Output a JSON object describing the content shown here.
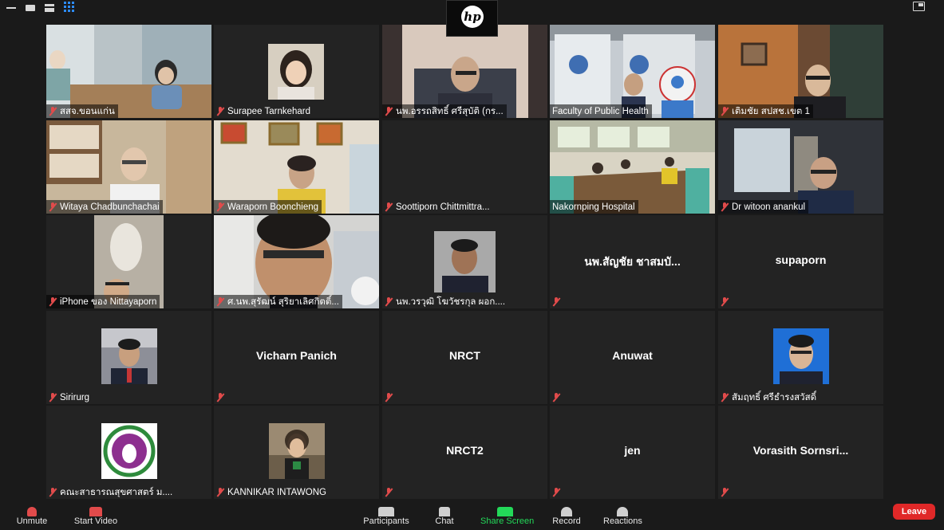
{
  "meeting": {
    "brand_logo": "hp",
    "participants": [
      {
        "name": "สสจ.ขอนแก่น",
        "muted": true,
        "video": true
      },
      {
        "name": "Surapee Tarnkehard",
        "muted": true,
        "video": false,
        "has_photo": true
      },
      {
        "name": "นพ.อรรถสิทธิ์ ศรีสุบัติ (กร...",
        "muted": true,
        "video": true
      },
      {
        "name": "Faculty of Public Health",
        "muted": false,
        "video": true,
        "active_speaker": true
      },
      {
        "name": "เติมชัย สปสช.เขต 1",
        "muted": true,
        "video": true
      },
      {
        "name": "Witaya Chadbunchachai",
        "muted": true,
        "video": true
      },
      {
        "name": "Waraporn Boonchieng",
        "muted": true,
        "video": true
      },
      {
        "name": "Soottiporn Chittmittra...",
        "muted": true,
        "video": false
      },
      {
        "name": "Nakornping Hospital",
        "muted": false,
        "video": true
      },
      {
        "name": "Dr witoon anankul",
        "muted": true,
        "video": true
      },
      {
        "name": "iPhone ของ Nittayaporn",
        "muted": true,
        "video": true
      },
      {
        "name": "ศ.นพ.สุรัฒน์ สุริยาเลิศกิตติ์...",
        "muted": true,
        "video": true
      },
      {
        "name": "นพ.วรวุฒิ โฆวัชรกุล ผอก....",
        "muted": true,
        "video": false,
        "has_photo": true
      },
      {
        "name": "นพ.สัญชัย ชาสมบั...",
        "muted": true,
        "video": false,
        "centered_name": true
      },
      {
        "name": "supaporn",
        "muted": true,
        "video": false,
        "centered_name": true
      },
      {
        "name": "Sirirurg",
        "muted": true,
        "video": false,
        "has_photo": true
      },
      {
        "name": "Vicharn Panich",
        "muted": true,
        "video": false,
        "centered_name": true
      },
      {
        "name": "NRCT",
        "muted": true,
        "video": false,
        "centered_name": true
      },
      {
        "name": "Anuwat",
        "muted": true,
        "video": false,
        "centered_name": true
      },
      {
        "name": "สัมฤทธิ์ ศรีธำรงสวัสดิ์",
        "muted": true,
        "video": false,
        "has_photo": true
      },
      {
        "name": "คณะสาธารณสุขศาสตร์ ม....",
        "muted": true,
        "video": false,
        "has_photo": true
      },
      {
        "name": "KANNIKAR INTAWONG",
        "muted": true,
        "video": false,
        "has_photo": true
      },
      {
        "name": "NRCT2",
        "muted": true,
        "video": false,
        "centered_name": true
      },
      {
        "name": "jen",
        "muted": true,
        "video": false,
        "centered_name": true
      },
      {
        "name": "Vorasith Sornsri...",
        "muted": true,
        "video": false,
        "centered_name": true
      }
    ]
  },
  "toolbar": {
    "unmute": "Unmute",
    "start_video": "Start Video",
    "participants": "Participants",
    "chat": "Chat",
    "share_screen": "Share Screen",
    "record": "Record",
    "reactions": "Reactions",
    "leave": "Leave",
    "share_color": "#23d959"
  },
  "colors": {
    "active_speaker_border": "#e3df49",
    "grid_icon": "#2d8cff",
    "leave_button": "#e02828",
    "mic_muted": "#e14b4b"
  }
}
